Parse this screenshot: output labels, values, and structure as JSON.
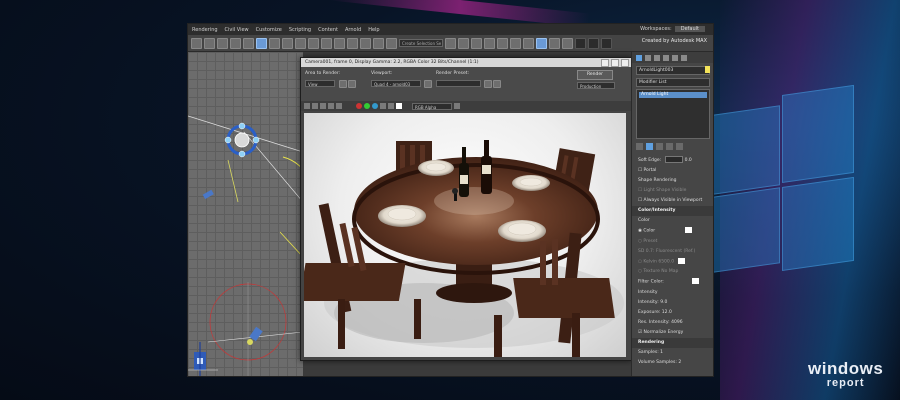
{
  "app": {
    "menu": [
      "Rendering",
      "Civil View",
      "Customize",
      "Scripting",
      "Content",
      "Arnold",
      "Help"
    ],
    "workspaces_label": "Workspaces:",
    "workspace_value": "Default",
    "selection_set_placeholder": "Create Selection Se",
    "credit": "Created by Autodesk MAX"
  },
  "render_window": {
    "title": "Camera001, frame 0, Display Gamma: 2.2, RGBA Color 32 Bits/Channel (1:1)",
    "area_label": "Area to Render:",
    "area_value": "View",
    "viewport_label": "Viewport:",
    "viewport_value": "Quad 4 - arnold03",
    "preset_label": "Render Preset:",
    "render_button": "Render",
    "production_value": "Production",
    "channel_value": "RGB Alpha"
  },
  "command_panel": {
    "object_name": "ArnoldLight003",
    "modifier_list": "Modifier List",
    "stack_item": "Arnold Light",
    "soft_edge_label": "Soft Edge:",
    "soft_edge_value": "0.0",
    "portal_label": "Portal",
    "shape_rendering_label": "Shape Rendering",
    "light_shape_visible": "Light Shape Visible",
    "always_visible_viewport": "Always Visible in Viewport",
    "color_intensity_header": "Color/Intensity",
    "color_label": "Color",
    "color_option": "Color",
    "preset_option": "Preset",
    "preset_value": "SD 0.7: Fluorescent (Ref.)",
    "kelvin_label": "Kelvin",
    "kelvin_value": "6500.0",
    "texture_label": "Texture",
    "texture_value": "No Map",
    "filter_color_label": "Filter Color:",
    "intensity_header": "Intensity",
    "intensity_label": "Intensity:",
    "intensity_value": "9.0",
    "exposure_label": "Exposure:",
    "exposure_value": "12.0",
    "res_intensity_label": "Res. Intensity:",
    "res_intensity_value": "4096",
    "normalize_label": "Normalize Energy",
    "rendering_header": "Rendering",
    "samples_label": "Samples:",
    "samples_value": "1",
    "volume_samples_label": "Volume Samples:",
    "volume_samples_value": "2"
  },
  "brand": {
    "line1": "windows",
    "line2": "report"
  },
  "colors": {
    "accent": "#5fa0e0",
    "light_swatch": "#f3e35a",
    "table_wood": "#5a3424",
    "chair_wood": "#4a2a1c"
  }
}
